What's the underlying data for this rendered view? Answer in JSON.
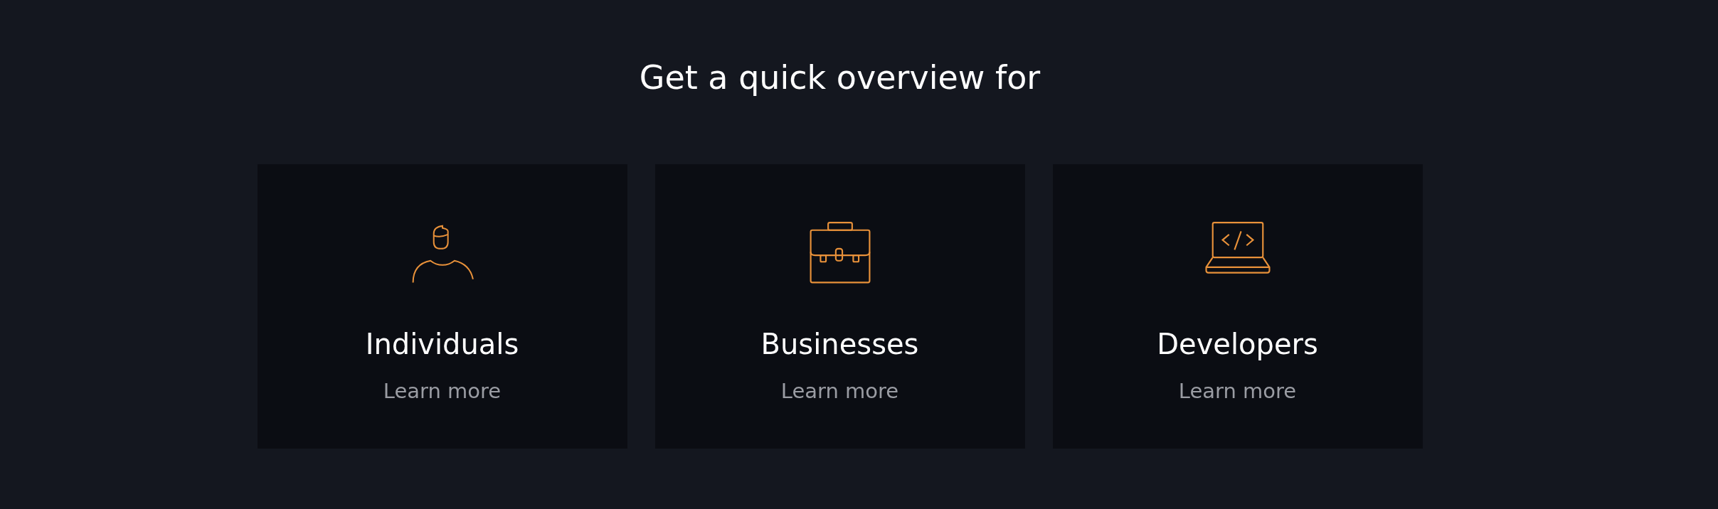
{
  "heading": "Get a quick overview for",
  "cards": [
    {
      "kind": "person",
      "title": "Individuals",
      "link": "Learn more"
    },
    {
      "kind": "briefcase",
      "title": "Businesses",
      "link": "Learn more"
    },
    {
      "kind": "laptop",
      "title": "Developers",
      "link": "Learn more"
    }
  ]
}
